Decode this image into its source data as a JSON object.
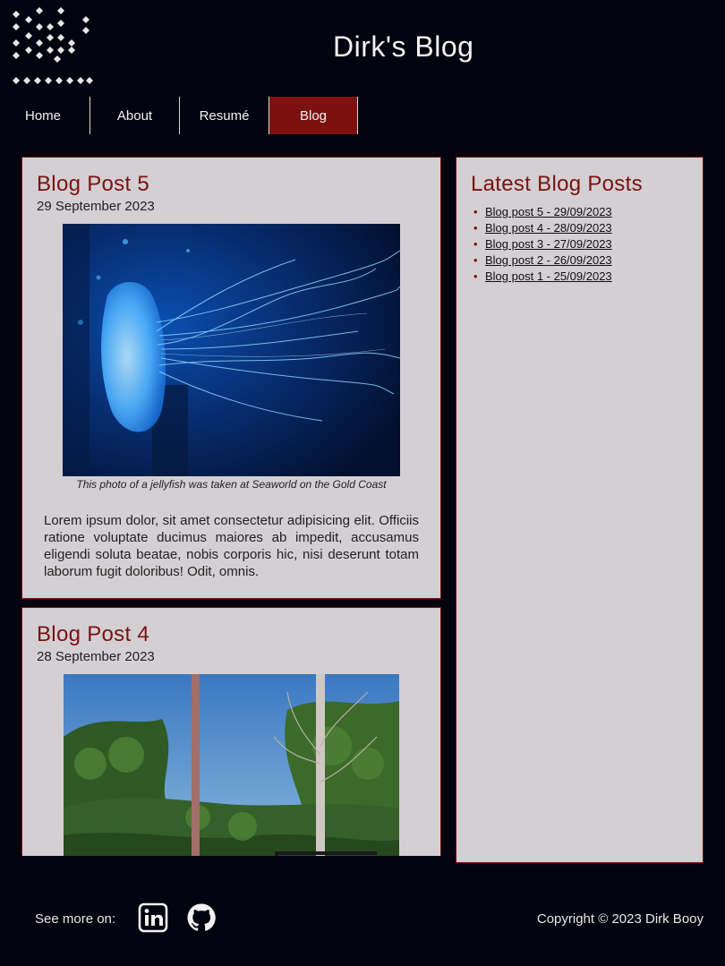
{
  "site": {
    "title": "Dirk's Blog"
  },
  "nav": {
    "items": [
      {
        "label": "Home"
      },
      {
        "label": "About"
      },
      {
        "label": "Resumé"
      },
      {
        "label": "Blog"
      }
    ],
    "active": "Blog"
  },
  "posts": [
    {
      "title": "Blog Post 5",
      "date": "29 September 2023",
      "caption": "This photo of a jellyfish was taken at Seaworld on the Gold Coast",
      "body": "Lorem ipsum dolor, sit amet consectetur adipisicing elit. Officiis ratione voluptate ducimus maiores ab impedit, accusamus eligendi soluta beatae, nobis corporis hic, nisi deserunt totam laborum fugit doloribus! Odit, omnis."
    },
    {
      "title": "Blog Post 4",
      "date": "28 September 2023"
    }
  ],
  "sidebar": {
    "title": "Latest Blog Posts",
    "links": [
      "Blog post 5 - 29/09/2023",
      "Blog post 4 - 28/09/2023",
      "Blog post 3 - 27/09/2023",
      "Blog post 2 - 26/09/2023",
      "Blog post 1 - 25/09/2023"
    ]
  },
  "footer": {
    "see_more": "See more on:",
    "copyright": "Copyright © 2023 Dirk Booy",
    "icons": [
      "linkedin-icon",
      "github-icon"
    ]
  },
  "colors": {
    "background": "#03030f",
    "accent": "#7b120f",
    "panel": "#d3cfd3"
  }
}
